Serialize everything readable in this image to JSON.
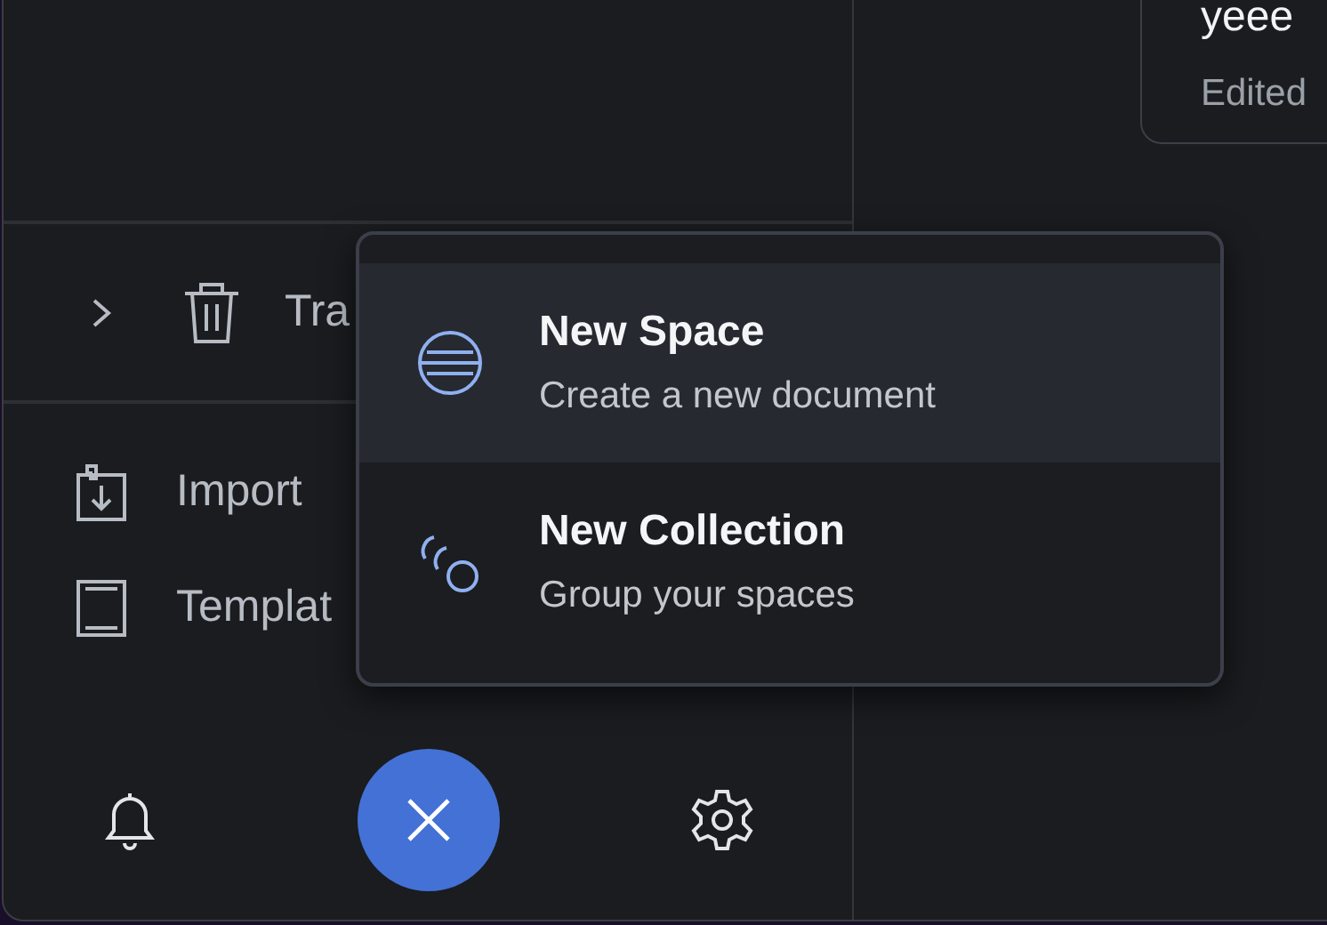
{
  "card": {
    "title": "yeee",
    "meta": "Edited"
  },
  "sidebar": {
    "trash": {
      "label": "Tra",
      "expanded": false
    },
    "items": [
      {
        "kind": "import",
        "label": "Import"
      },
      {
        "kind": "templates",
        "label": "Templat"
      }
    ]
  },
  "bottom_bar": {
    "fab_open": true
  },
  "menu": {
    "items": [
      {
        "kind": "space",
        "title": "New Space",
        "subtitle": "Create a new document",
        "selected": true
      },
      {
        "kind": "collection",
        "title": "New Collection",
        "subtitle": "Group your spaces",
        "selected": false
      }
    ]
  }
}
